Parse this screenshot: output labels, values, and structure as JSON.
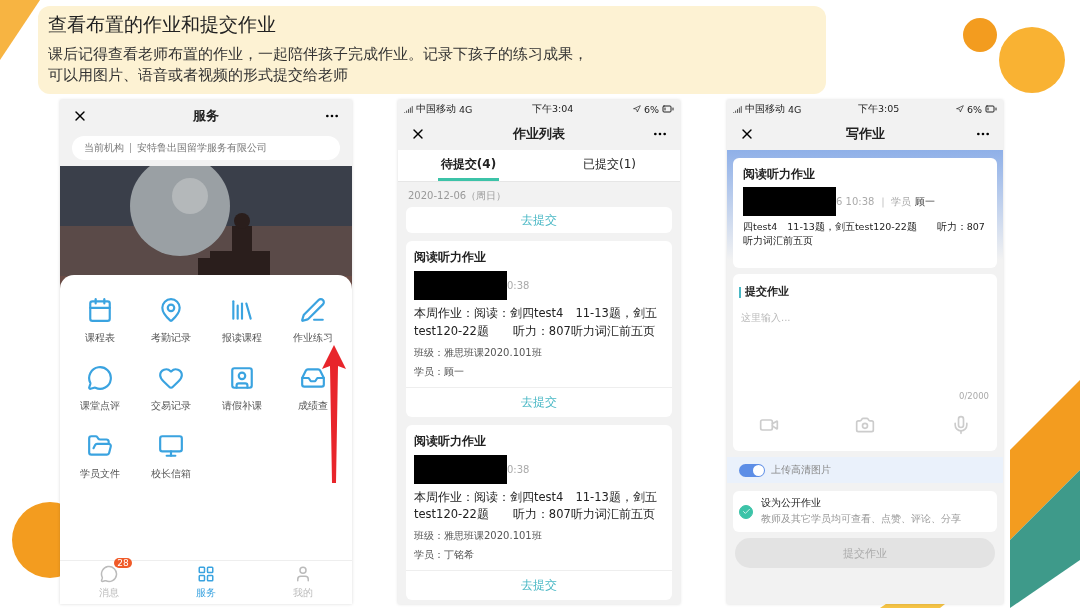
{
  "slide": {
    "title": "查看布置的作业和提交作业",
    "description": [
      "课后记得查看老师布置的作业，一起陪伴孩子完成作业。记录下孩子的练习成果，",
      "可以用图片、语音或者视频的形式提交给老师"
    ]
  },
  "service_screen": {
    "title": "服务",
    "org_label": "当前机构",
    "org_name": "安特鲁出国留学服务有限公司",
    "grid": [
      {
        "label": "课程表",
        "kind": "calendar"
      },
      {
        "label": "考勤记录",
        "kind": "pin"
      },
      {
        "label": "报读课程",
        "kind": "books"
      },
      {
        "label": "作业练习",
        "kind": "pen"
      },
      {
        "label": "课堂点评",
        "kind": "chat"
      },
      {
        "label": "交易记录",
        "kind": "heart"
      },
      {
        "label": "请假补课",
        "kind": "person"
      },
      {
        "label": "成绩查",
        "kind": "tray"
      },
      {
        "label": "学员文件",
        "kind": "folder"
      },
      {
        "label": "校长信箱",
        "kind": "monitor"
      }
    ],
    "tabs": [
      {
        "label": "消息",
        "badge": "28",
        "selected": false,
        "kind": "chat"
      },
      {
        "label": "服务",
        "selected": true,
        "kind": "grid"
      },
      {
        "label": "我的",
        "selected": false,
        "kind": "user"
      }
    ]
  },
  "list_screen": {
    "status": {
      "carrier": "中国移动",
      "network": "4G",
      "time": "下午3:04",
      "battery": "6%"
    },
    "title": "作业列表",
    "tabs": [
      {
        "label": "待提交(4)",
        "selected": true
      },
      {
        "label": "已提交(1)",
        "selected": false
      }
    ],
    "date": "2020-12-06（周日）",
    "top_action": "去提交",
    "cards": [
      {
        "title": "阅读听力作业",
        "time": "0:38",
        "body": "本周作业：阅读：剑四test4　11-13题，剑五test120-22题　　听力：807听力词汇前五页",
        "class_line": "班级：雅思班课2020.101班",
        "student": "学员：顾一",
        "action": "去提交"
      },
      {
        "title": "阅读听力作业",
        "time": "0:38",
        "body": "本周作业：阅读：剑四test4　11-13题，剑五test120-22题　　听力：807听力词汇前五页",
        "class_line": "班级：雅思班课2020.101班",
        "student": "学员：丁铭希",
        "action": "去提交"
      }
    ]
  },
  "write_screen": {
    "status": {
      "carrier": "中国移动",
      "network": "4G",
      "time": "下午3:05",
      "battery": "6%"
    },
    "title": "写作业",
    "card": {
      "title": "阅读听力作业",
      "meta": "6 10:38 ｜ 学员",
      "student": "顾一",
      "body": "四test4　11-13题，剑五test120-22题　　听力：807听力词汇前五页"
    },
    "section_title": "提交作业",
    "placeholder": "这里输入...",
    "counter": "0/2000",
    "hd_toggle": {
      "label": "上传高清图片",
      "on": true
    },
    "public": {
      "label": "设为公开作业",
      "hint": "教师及其它学员均可查看、点赞、评论、分享",
      "checked": true
    },
    "submit": "提交作业"
  }
}
